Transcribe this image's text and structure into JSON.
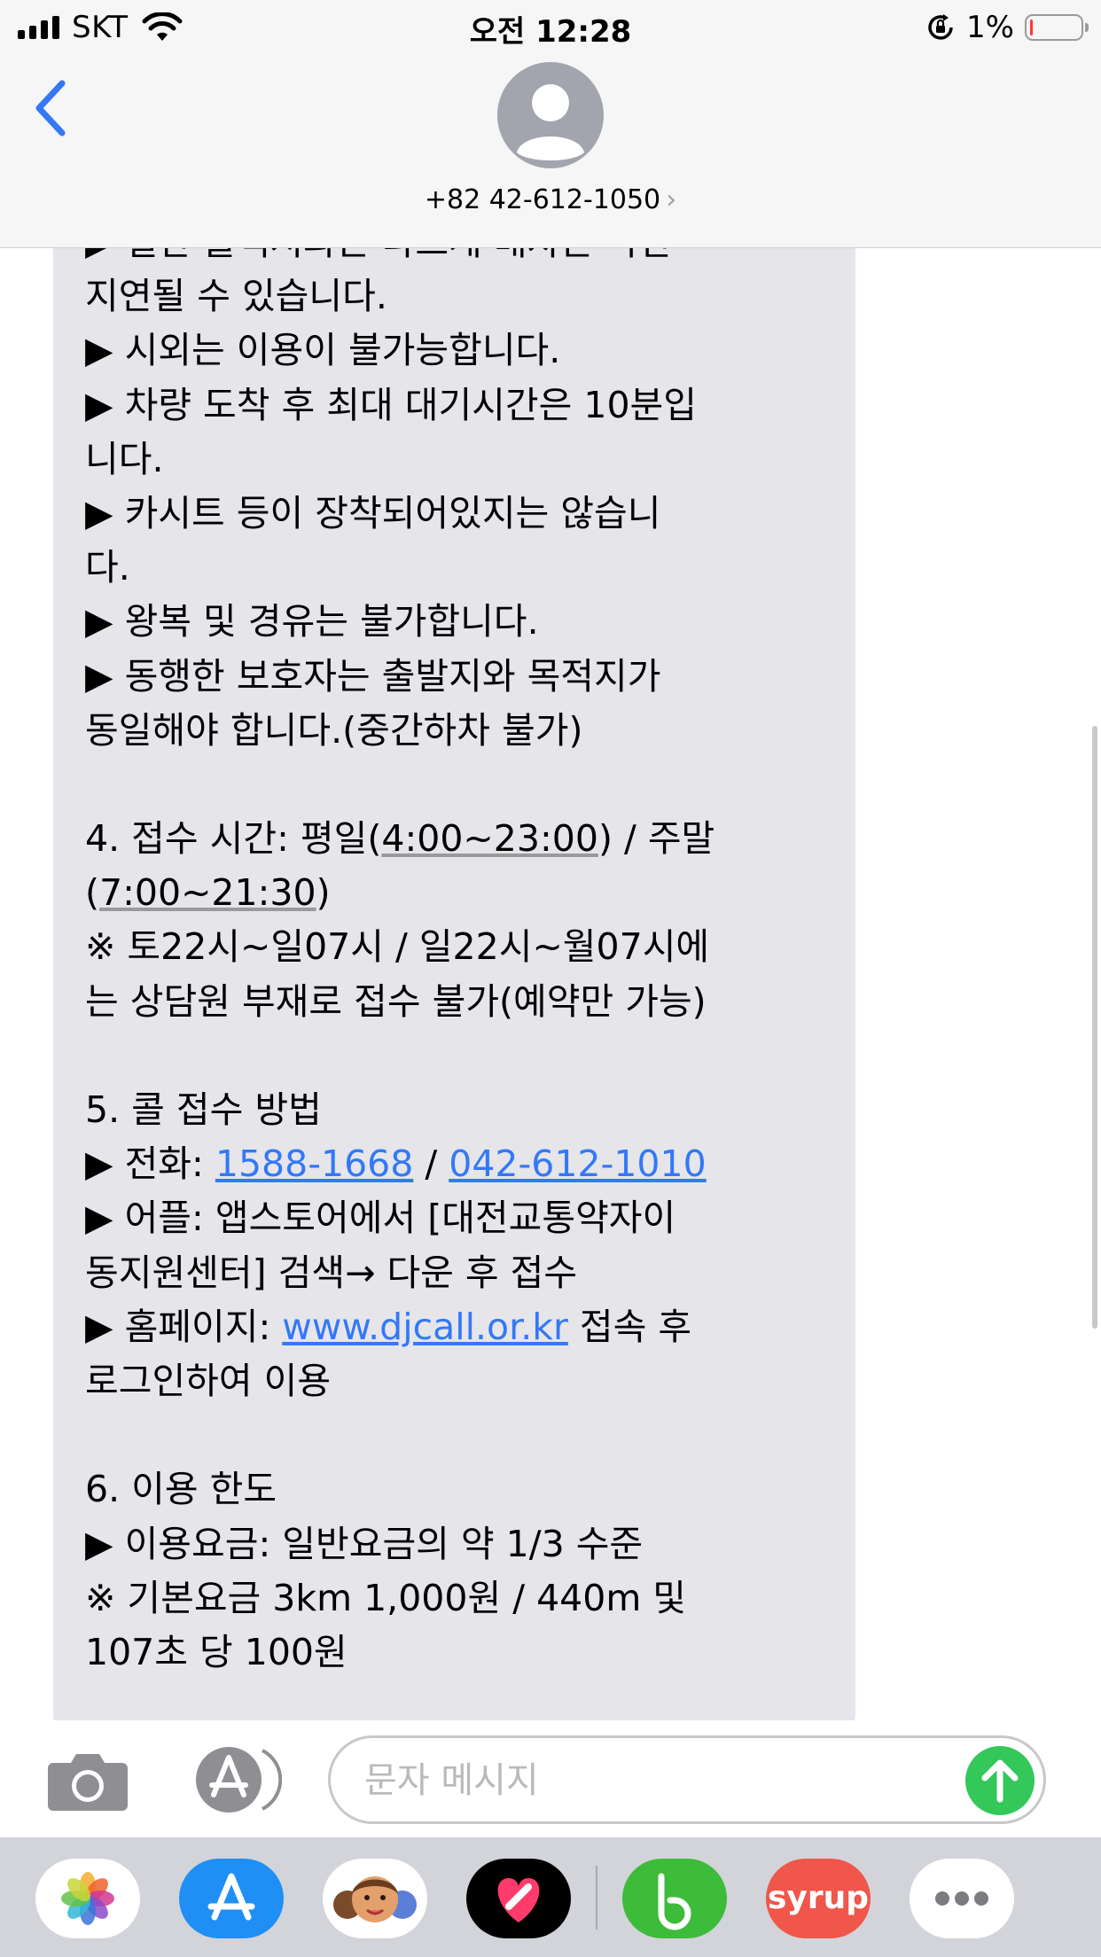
{
  "status_bar": {
    "carrier": "SKT",
    "time": "오전 12:28",
    "battery_percent": "1%",
    "battery_level": 0.01,
    "battery_color": "#ff3b30",
    "icons": [
      "signal-icon",
      "wifi-icon",
      "orientation-lock-icon",
      "battery-icon"
    ]
  },
  "header": {
    "back_icon": "chevron-left-icon",
    "avatar_icon": "person-icon",
    "contact": "+82 42-612-1050",
    "chevron": "›"
  },
  "message": {
    "lines": [
      "   ▶ 일반 콜택시와는 다르게 배차는 약간",
      "지연될 수 있습니다.",
      "   ▶ 시외는 이용이 불가능합니다.",
      "   ▶ 차량 도착 후 최대 대기시간은 10분입",
      "니다.",
      "   ▶ 카시트 등이 장착되어있지는 않습니",
      "다.",
      "   ▶ 왕복 및 경유는 불가합니다.",
      "   ▶ 동행한 보호자는 출발지와 목적지가",
      "동일해야 합니다.(중간하차 불가)",
      "",
      " 4. 접수 시간: 평일(",
      "4:00~23:00",
      ") / 주말",
      "(",
      "7:00~21:30",
      ")",
      "   ※ 토22시~일07시 / 일22시~월07시에",
      "는 상담원 부재로 접수 불가(예약만 가능)",
      "",
      "5. 콜 접수 방법",
      "   ▶ 전화: ",
      "1588-1668",
      " / ",
      "042-612-1010",
      "   ▶ 어플: 앱스토어에서 [대전교통약자이",
      "동지원센터] 검색→ 다운 후 접수",
      "   ▶ 홈페이지: ",
      "www.djcall.or.kr",
      " 접속 후",
      "로그인하여 이용",
      "",
      "6. 이용 한도",
      "   ▶ 이용요금: 일반요금의 약 1/3 수준",
      "   ※ 기본요금 3km 1,000원 / 440m 및",
      "107초 당 100원"
    ],
    "link_color": "#3478f6",
    "bubble_color": "#e5e5ea"
  },
  "input_bar": {
    "camera_icon": "camera-icon",
    "apps_icon": "app-store-icon",
    "placeholder": "문자 메시지",
    "send_icon": "arrow-up-icon"
  },
  "app_drawer": {
    "apps": [
      "photos",
      "app-store",
      "memoji",
      "digital-touch",
      "b-app",
      "syrup",
      "more"
    ],
    "syrup_label": "syrup"
  }
}
